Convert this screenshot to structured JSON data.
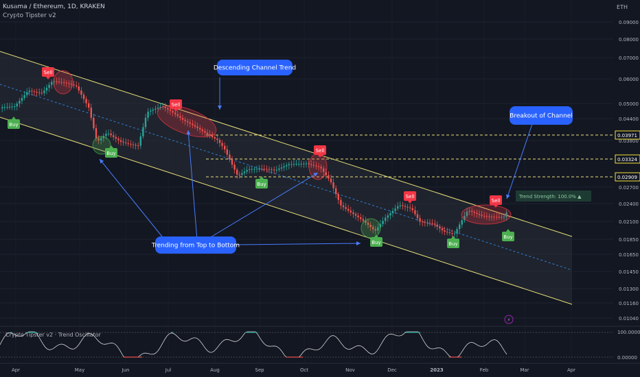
{
  "header": {
    "symbol": "Kusama / Ethereum, 1D, KRAKEN",
    "indicator": "Crypto Tipster v2",
    "unit": "ETH"
  },
  "chart_data": {
    "type": "candlestick",
    "price_axis": {
      "scale": "log",
      "ticks": [
        "0.09000",
        "0.08000",
        "0.07000",
        "0.06000",
        "0.05000",
        "0.04400",
        "0.03800",
        "0.02700",
        "0.02400",
        "0.02100",
        "0.01850",
        "0.01650",
        "0.01450",
        "0.01300",
        "0.01160",
        "0.01040"
      ]
    },
    "price_tags": [
      {
        "value": "0.03971",
        "color": "#f5e33a"
      },
      {
        "value": "0.03324",
        "color": "#f5e33a"
      },
      {
        "value": "0.02909",
        "color": "#f5e33a"
      }
    ],
    "time_axis": [
      "Apr",
      "May",
      "Jun",
      "Jul",
      "Aug",
      "Sep",
      "Oct",
      "Nov",
      "Dec",
      "2023",
      "Feb",
      "Mar",
      "Apr"
    ],
    "annotations": {
      "channel_title": "Descending Channel Trend",
      "breakout": "Breakout of Channel",
      "trending": "Trending from Top to Bottom",
      "trend_strength": "Trend Strength: 100.0% ▲"
    },
    "signals": [
      {
        "label": "Sell",
        "type": "sell"
      },
      {
        "label": "Sell",
        "type": "sell"
      },
      {
        "label": "Sell",
        "type": "sell"
      },
      {
        "label": "Sell",
        "type": "sell"
      },
      {
        "label": "Sell",
        "type": "sell"
      },
      {
        "label": "Buy",
        "type": "buy"
      },
      {
        "label": "Buy",
        "type": "buy"
      },
      {
        "label": "Buy",
        "type": "buy"
      },
      {
        "label": "Buy",
        "type": "buy"
      },
      {
        "label": "Buy",
        "type": "buy"
      },
      {
        "label": "Buy",
        "type": "buy"
      }
    ],
    "oscillator": {
      "title": "Crypto Tipster v2 · Trend Oscillator",
      "ticks": [
        "100.00000",
        "0.00000"
      ]
    },
    "colors": {
      "up": "#26a69a",
      "down": "#ef5350",
      "sell": "#f23645",
      "buy": "#4caf50",
      "callout": "#2962ff",
      "channel": "#e8e07a"
    }
  }
}
